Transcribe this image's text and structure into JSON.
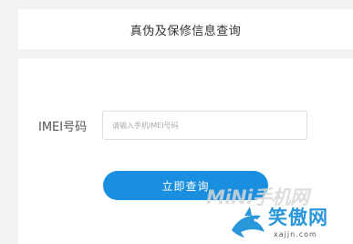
{
  "header": {
    "title": "真伪及保修信息查询"
  },
  "form": {
    "imei_label": "IMEI号码",
    "imei_placeholder": "请输入手机IMEI号码",
    "imei_value": "",
    "submit_label": "立即查询"
  },
  "watermark": {
    "mini_text": "MiNi手机网",
    "brand_text": "笑傲网",
    "site_text": "xajjn.com",
    "icon": "shark-icon"
  },
  "colors": {
    "accent": "#1a8fe0",
    "brand": "#2b97db",
    "background": "#f2f2f2"
  }
}
